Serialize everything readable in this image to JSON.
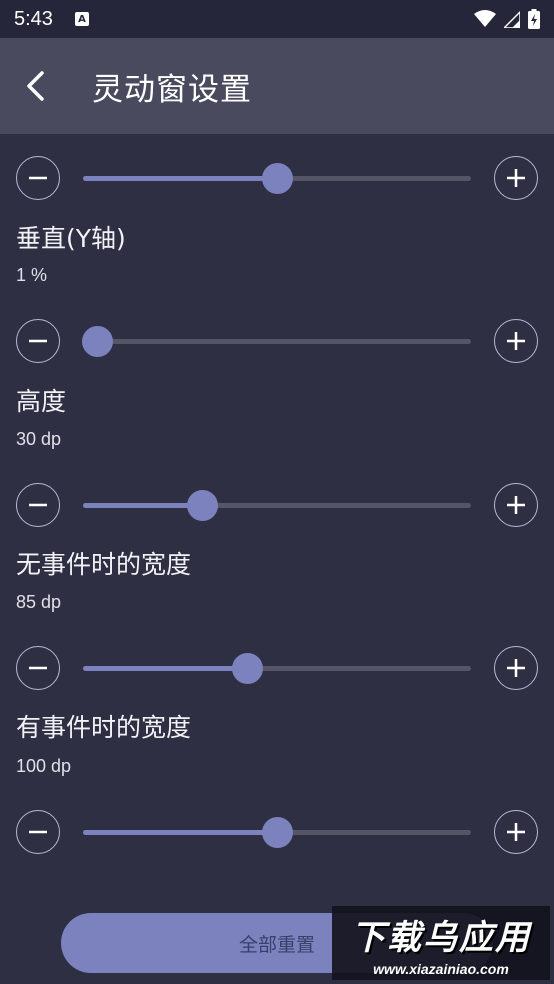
{
  "status_bar": {
    "time": "5:43",
    "notification_icon": "A"
  },
  "app_bar": {
    "title": "灵动窗设置"
  },
  "sliders": [
    {
      "id": "horizontal",
      "fraction": 0.5
    },
    {
      "id": "vertical",
      "label": "垂直(Y轴)",
      "value": "1 %",
      "fraction": 0.02
    },
    {
      "id": "height",
      "label": "高度",
      "value": "30 dp",
      "fraction": 0.3
    },
    {
      "id": "width-idle",
      "label": "无事件时的宽度",
      "value": "85 dp",
      "fraction": 0.42
    },
    {
      "id": "width-active",
      "label": "有事件时的宽度",
      "value": "100 dp",
      "fraction": 0.5
    }
  ],
  "reset": {
    "label": "全部重置"
  },
  "watermark": {
    "main": "下载乌应用",
    "url": "www.xiazainiao.com"
  },
  "colors": {
    "background": "#2f2f43",
    "app_bar": "#4a4a5e",
    "accent": "#7b82bd",
    "track": "#555566"
  }
}
